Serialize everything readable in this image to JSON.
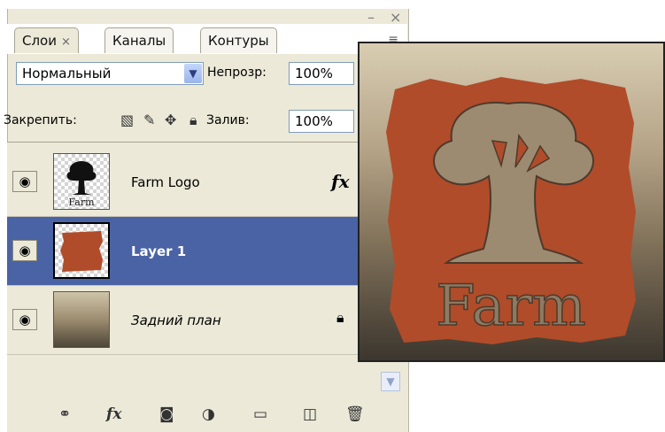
{
  "window": {
    "minimize": "–",
    "close": "×"
  },
  "tabs": [
    {
      "label": "Слои",
      "close": "×"
    },
    {
      "label": "Каналы"
    },
    {
      "label": "Контуры"
    }
  ],
  "panel_menu_icon": "≡",
  "blend": {
    "mode": "Нормальный",
    "opacity_label": "Непрозр:",
    "opacity_value": "100%"
  },
  "lock": {
    "label": "Закрепить:",
    "fill_label": "Залив:",
    "fill_value": "100%"
  },
  "layers": [
    {
      "name": "Farm Logo",
      "fx": "fx",
      "visible": true,
      "selected": false
    },
    {
      "name": "Layer 1",
      "visible": true,
      "selected": true
    },
    {
      "name": "Задний план",
      "visible": true,
      "locked": true,
      "selected": false
    }
  ],
  "thumb_text": "Farm",
  "preview": {
    "text": "Farm",
    "logo_color": "#b04c2a"
  },
  "bottom_icons": [
    "link-icon",
    "fx-icon",
    "mask-icon",
    "adjustment-icon",
    "folder-icon",
    "new-layer-icon",
    "trash-icon"
  ]
}
